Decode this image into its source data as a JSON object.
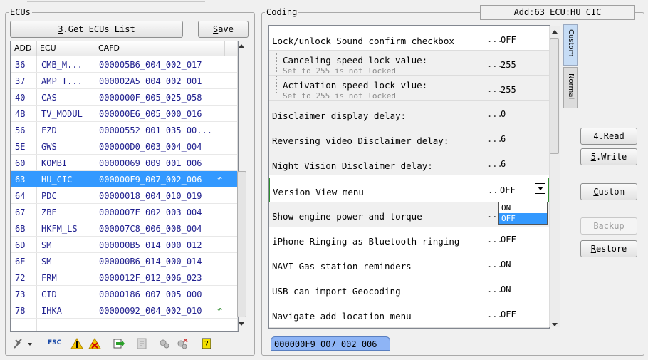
{
  "ecus_group": {
    "title": "ECUs"
  },
  "buttons": {
    "get_list_prefix": "3",
    "get_list_rest": ".Get ECUs List",
    "save_u": "S",
    "save_rest": "ave",
    "read_u": "4",
    "read_rest": ".Read",
    "write_u": "5",
    "write_rest": ".Write",
    "custom_u": "C",
    "custom_rest": "ustom",
    "backup_u": "B",
    "backup_rest": "ackup",
    "restore_u": "R",
    "restore_rest": "estore"
  },
  "ecu_table": {
    "columns": [
      "ADD",
      "ECU",
      "CAFD"
    ],
    "rows": [
      {
        "add": "36",
        "ecu": "CMB_M...",
        "cafd": "000005B6_004_002_017"
      },
      {
        "add": "37",
        "ecu": "AMP_T...",
        "cafd": "000002A5_004_002_001"
      },
      {
        "add": "40",
        "ecu": "CAS",
        "cafd": "0000000F_005_025_058"
      },
      {
        "add": "4B",
        "ecu": "TV_MODUL",
        "cafd": "000000E6_005_000_016"
      },
      {
        "add": "56",
        "ecu": "FZD",
        "cafd": "00000552_001_035_00..."
      },
      {
        "add": "5E",
        "ecu": "GWS",
        "cafd": "000000D0_003_004_004"
      },
      {
        "add": "60",
        "ecu": "KOMBI",
        "cafd": "00000069_009_001_006"
      },
      {
        "add": "63",
        "ecu": "HU_CIC",
        "cafd": "000000F9_007_002_006"
      },
      {
        "add": "64",
        "ecu": "PDC",
        "cafd": "00000018_004_010_019"
      },
      {
        "add": "67",
        "ecu": "ZBE",
        "cafd": "0000007E_002_003_004"
      },
      {
        "add": "6B",
        "ecu": "HKFM_LS",
        "cafd": "000007C8_006_008_004"
      },
      {
        "add": "6D",
        "ecu": "SM",
        "cafd": "000000B5_014_000_012"
      },
      {
        "add": "6E",
        "ecu": "SM",
        "cafd": "000000B6_014_000_014"
      },
      {
        "add": "72",
        "ecu": "FRM",
        "cafd": "0000012F_012_006_023"
      },
      {
        "add": "73",
        "ecu": "CID",
        "cafd": "00000186_007_005_000"
      },
      {
        "add": "78",
        "ecu": "IHKA",
        "cafd": "00000092_004_002_010"
      }
    ]
  },
  "coding_group": {
    "title": "Coding",
    "address_info": "Add:63 ECU:HU CIC"
  },
  "coding_rows": {
    "r0": {
      "label": "Lock/unlock Sound confirm checkbox",
      "value": "OFF"
    },
    "r1": {
      "label": "Canceling speed lock value:",
      "sub": "Set to 255 is not locked",
      "value": "255"
    },
    "r2": {
      "label": "Activation speed lock vlue:",
      "sub": "Set to 255 is not locked",
      "value": "255"
    },
    "r3": {
      "label": "Disclaimer display delay:",
      "value": "0"
    },
    "r4": {
      "label": "Reversing video Disclaimer delay:",
      "value": "6"
    },
    "r5": {
      "label": "Night Vision Disclaimer delay:",
      "value": "6"
    },
    "r6": {
      "label": "Version View menu",
      "value": "OFF"
    },
    "r7": {
      "label": "Show engine power and torque",
      "value": ""
    },
    "r8": {
      "label": "iPhone Ringing as Bluetooth ringing",
      "value": "OFF"
    },
    "r9": {
      "label": "NAVI Gas station reminders",
      "value": "ON"
    },
    "r10": {
      "label": "USB can import Geocoding",
      "value": "ON"
    },
    "r11": {
      "label": "Navigate add location menu",
      "value": "OFF"
    }
  },
  "dots": "...",
  "dropdown": {
    "options": [
      "ON",
      "OFF"
    ],
    "selected": "OFF"
  },
  "side_tabs": {
    "custom": "Custom",
    "normal": "Normal"
  },
  "bottom_tab": {
    "label": "000000F9_007_002_006"
  },
  "toolbar": {
    "fsc": "FSC"
  },
  "colors": {
    "selection": "#3399ff",
    "tab_active": "#c6dcf5",
    "text_blue": "#1f1f8f"
  }
}
